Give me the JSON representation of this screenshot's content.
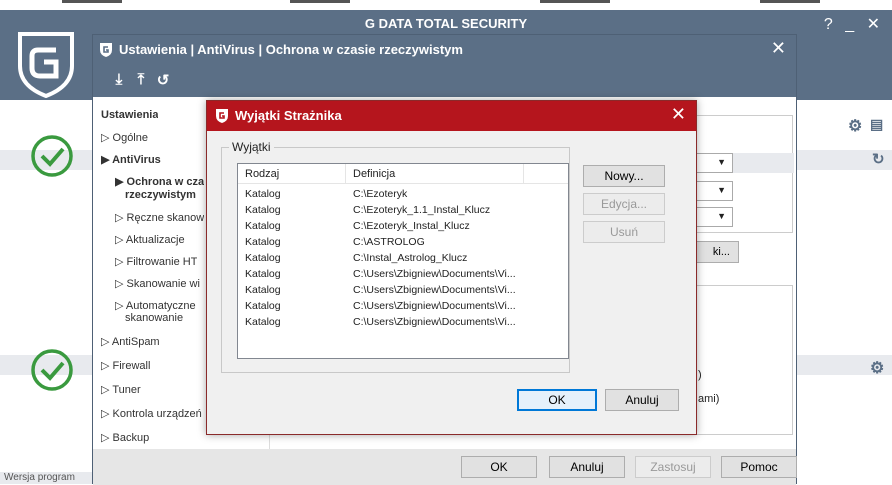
{
  "app": {
    "title": "G DATA TOTAL SECURITY",
    "window_controls": "?  _  ✕",
    "status_bar": "Wersja program"
  },
  "settings": {
    "title": "Ustawienia | AntiVirus | Ochrona w czasie rzeczywistym",
    "close": "✕",
    "toolbar": {
      "import_icon": "import-icon",
      "export_icon": "export-icon",
      "reset_icon": "reset-icon"
    },
    "nav": [
      {
        "label": "Ustawienia",
        "bold": true
      },
      {
        "label": "▷ Ogólne"
      },
      {
        "label": "▶ AntiVirus",
        "bold": true
      },
      {
        "label": "▶ Ochrona w cza",
        "bold": true
      },
      {
        "label": "rzeczywistym",
        "bold": true
      },
      {
        "label": "▷ Ręczne skanow"
      },
      {
        "label": "▷ Aktualizacje"
      },
      {
        "label": "▷ Filtrowanie HT"
      },
      {
        "label": "▷ Skanowanie wi"
      },
      {
        "label": "▷ Automatyczne"
      },
      {
        "label": "skanowanie"
      },
      {
        "label": "▷ AntiSpam"
      },
      {
        "label": "▷ Firewall"
      },
      {
        "label": "▷ Tuner"
      },
      {
        "label": "▷ Kontrola urządzeń"
      },
      {
        "label": "▷ Backup"
      }
    ],
    "right_fragments": {
      "button_partial": "ki...",
      "text1": ")",
      "text2": "ami)"
    },
    "footer": {
      "ok": "OK",
      "cancel": "Anuluj",
      "apply": "Zastosuj",
      "help": "Pomoc"
    }
  },
  "modal": {
    "title": "Wyjątki Strażnika",
    "close": "✕",
    "group_label": "Wyjątki",
    "columns": [
      "Rodzaj",
      "Definicja"
    ],
    "rows": [
      {
        "type": "Katalog",
        "definition": "C:\\Ezoteryk"
      },
      {
        "type": "Katalog",
        "definition": "C:\\Ezoteryk_1.1_Instal_Klucz"
      },
      {
        "type": "Katalog",
        "definition": "C:\\Ezoteryk_Instal_Klucz"
      },
      {
        "type": "Katalog",
        "definition": "C:\\ASTROLOG"
      },
      {
        "type": "Katalog",
        "definition": "C:\\Instal_Astrolog_Klucz"
      },
      {
        "type": "Katalog",
        "definition": "C:\\Users\\Zbigniew\\Documents\\Vi..."
      },
      {
        "type": "Katalog",
        "definition": "C:\\Users\\Zbigniew\\Documents\\Vi..."
      },
      {
        "type": "Katalog",
        "definition": "C:\\Users\\Zbigniew\\Documents\\Vi..."
      },
      {
        "type": "Katalog",
        "definition": "C:\\Users\\Zbigniew\\Documents\\Vi..."
      }
    ],
    "buttons": {
      "new": "Nowy...",
      "edit": "Edycja...",
      "delete": "Usuń",
      "ok": "OK",
      "cancel": "Anuluj"
    }
  },
  "colors": {
    "title_bar": "#5b6f86",
    "modal_title": "#b5151d",
    "check_green": "#3a9a3f",
    "default_button_border": "#0078d7"
  }
}
